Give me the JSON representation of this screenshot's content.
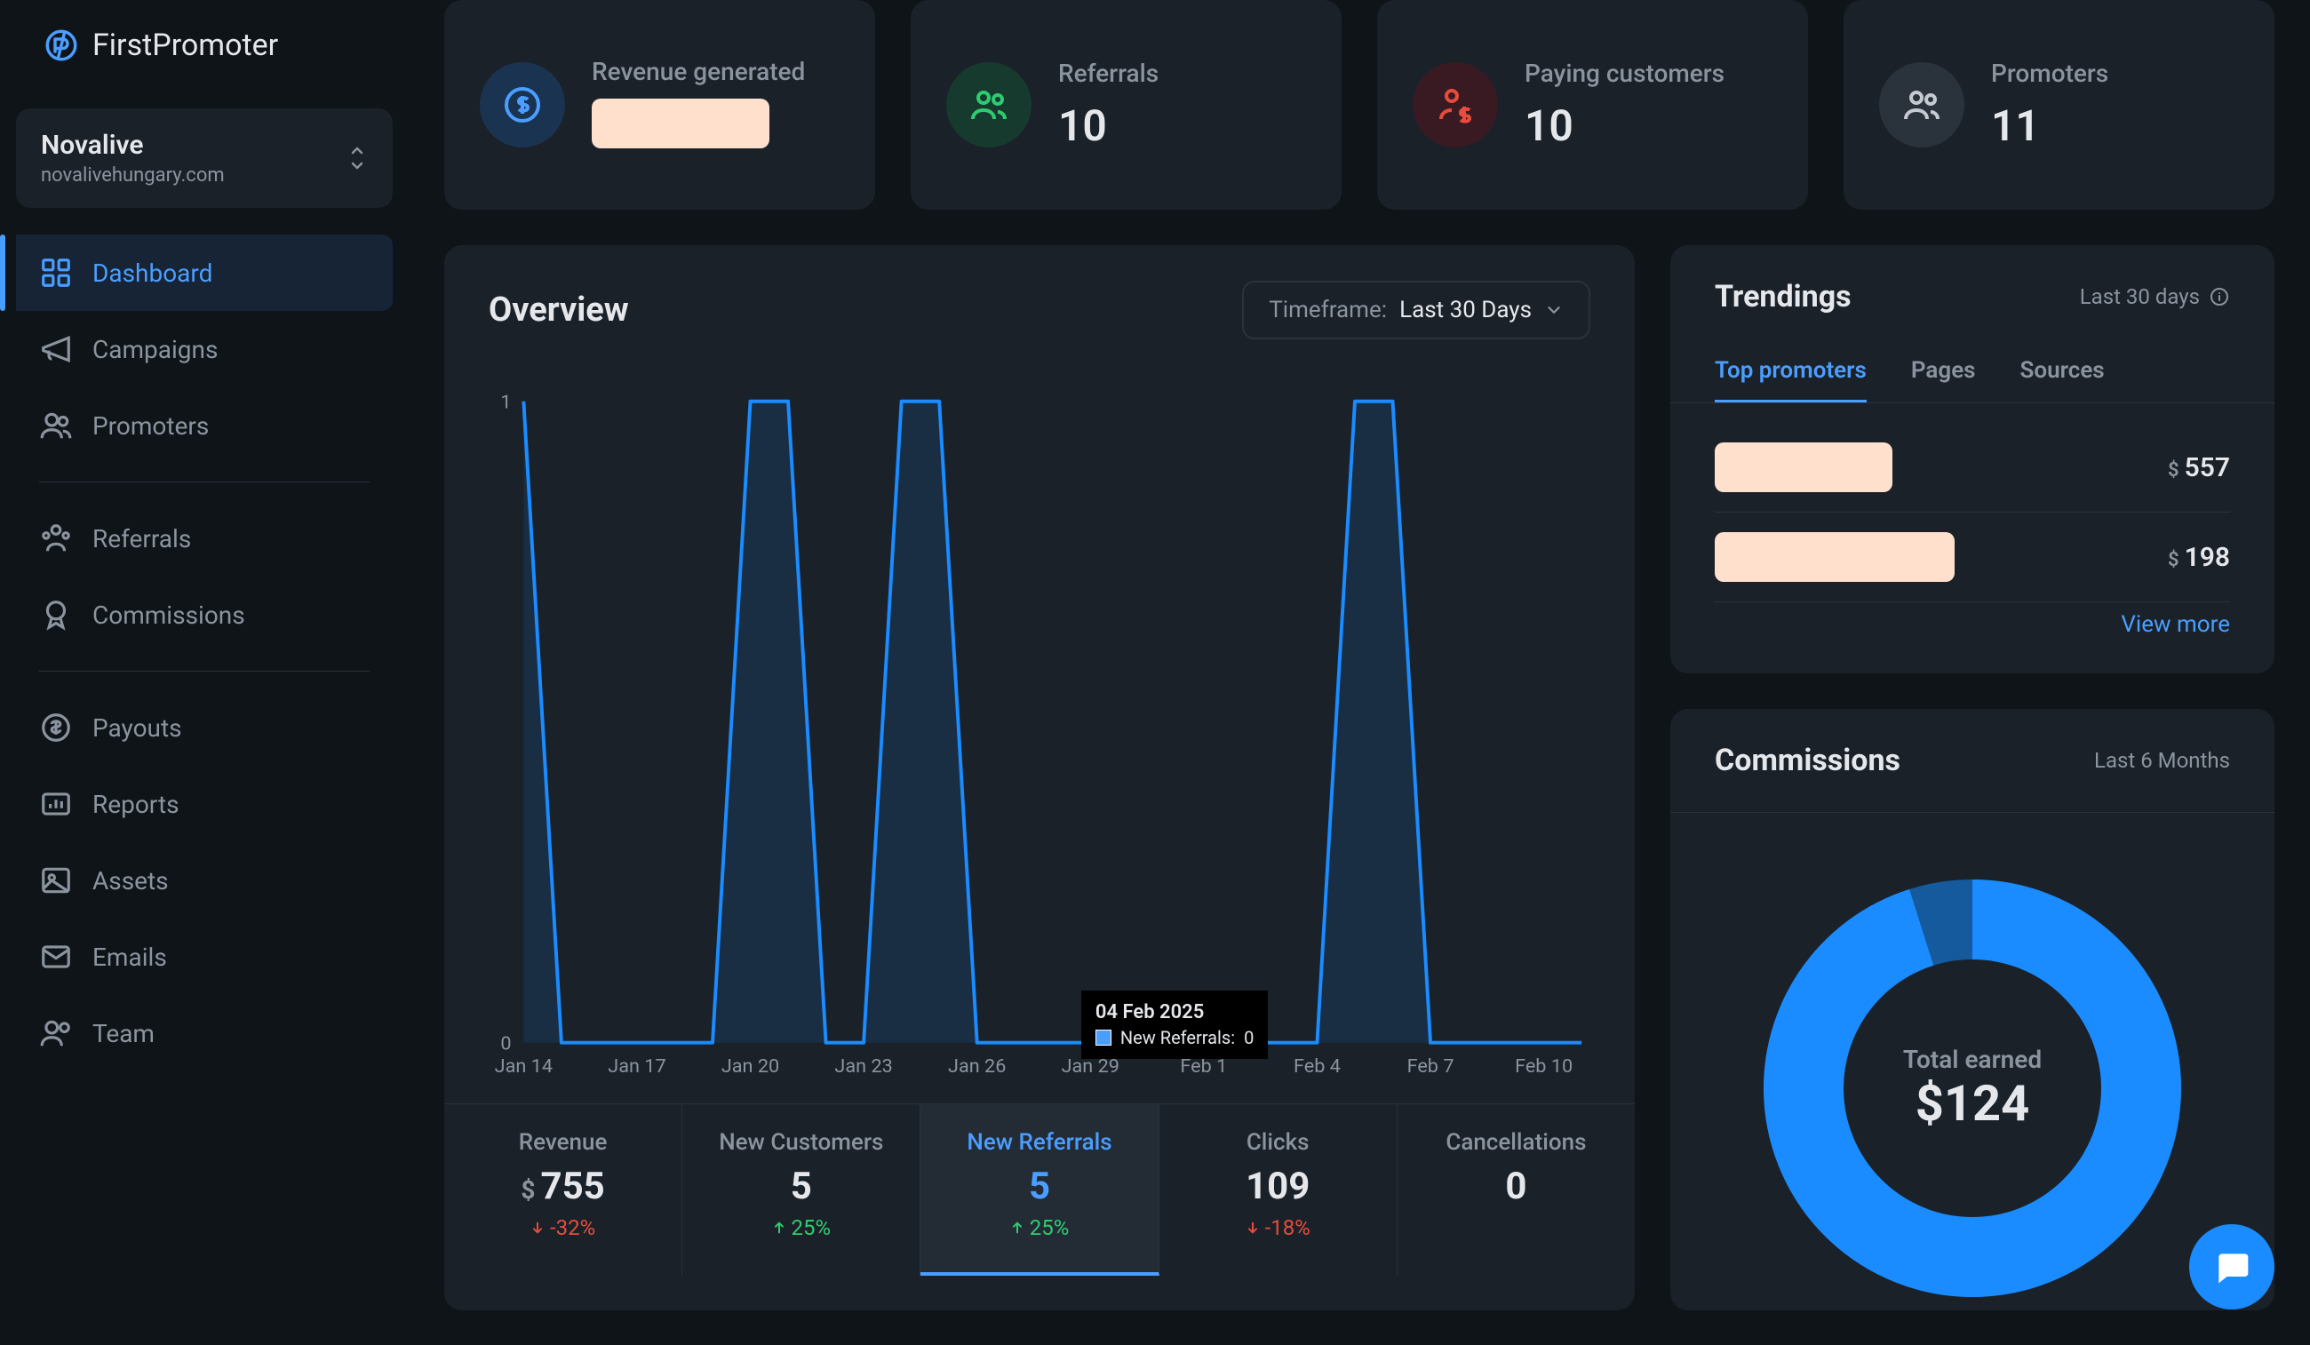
{
  "app": {
    "name": "FirstPromoter"
  },
  "org": {
    "name": "Novalive",
    "domain": "novalivehungary.com"
  },
  "nav": {
    "dashboard": "Dashboard",
    "campaigns": "Campaigns",
    "promoters": "Promoters",
    "referrals": "Referrals",
    "commissions": "Commissions",
    "payouts": "Payouts",
    "reports": "Reports",
    "assets": "Assets",
    "emails": "Emails",
    "team": "Team"
  },
  "cards": {
    "revenue": {
      "label": "Revenue generated"
    },
    "referrals": {
      "label": "Referrals",
      "value": "10"
    },
    "paying": {
      "label": "Paying customers",
      "value": "10"
    },
    "promoters": {
      "label": "Promoters",
      "value": "11"
    }
  },
  "overview": {
    "title": "Overview",
    "timeframe_label": "Timeframe:",
    "timeframe_value": "Last 30 Days",
    "tooltip": {
      "date": "04 Feb 2025",
      "series": "New Referrals:",
      "value": "0"
    }
  },
  "chart_data": {
    "type": "line",
    "title": "New Referrals",
    "ylabel": "",
    "ylim": [
      0,
      1
    ],
    "yticks": [
      0,
      1
    ],
    "categories": [
      "Jan 14",
      "Jan 15",
      "Jan 16",
      "Jan 17",
      "Jan 18",
      "Jan 19",
      "Jan 20",
      "Jan 21",
      "Jan 22",
      "Jan 23",
      "Jan 24",
      "Jan 25",
      "Jan 26",
      "Jan 27",
      "Jan 28",
      "Jan 29",
      "Jan 30",
      "Jan 31",
      "Feb 1",
      "Feb 2",
      "Feb 3",
      "Feb 4",
      "Feb 5",
      "Feb 6",
      "Feb 7",
      "Feb 8",
      "Feb 9",
      "Feb 10",
      "Feb 11"
    ],
    "x_tick_labels": [
      "Jan 14",
      "Jan 17",
      "Jan 20",
      "Jan 23",
      "Jan 26",
      "Jan 29",
      "Feb 1",
      "Feb 4",
      "Feb 7",
      "Feb 10"
    ],
    "series": [
      {
        "name": "New Referrals",
        "color": "#1a8cff",
        "values": [
          1,
          0,
          0,
          0,
          0,
          0,
          1,
          1,
          0,
          0,
          1,
          1,
          0,
          0,
          0,
          0,
          0,
          0,
          0,
          0,
          0,
          0,
          1,
          1,
          0,
          0,
          0,
          0,
          0
        ]
      }
    ]
  },
  "stats": {
    "revenue": {
      "label": "Revenue",
      "value": "755",
      "currency": "$",
      "delta": "-32%",
      "dir": "down"
    },
    "customers": {
      "label": "New Customers",
      "value": "5",
      "delta": "25%",
      "dir": "up"
    },
    "referrals": {
      "label": "New Referrals",
      "value": "5",
      "delta": "25%",
      "dir": "up"
    },
    "clicks": {
      "label": "Clicks",
      "value": "109",
      "delta": "-18%",
      "dir": "down"
    },
    "cancel": {
      "label": "Cancellations",
      "value": "0"
    }
  },
  "trendings": {
    "title": "Trendings",
    "sub": "Last 30 days",
    "tabs": {
      "top": "Top promoters",
      "pages": "Pages",
      "sources": "Sources"
    },
    "rows": [
      {
        "amount": "557"
      },
      {
        "amount": "198"
      }
    ],
    "view_more": "View more"
  },
  "commissions": {
    "title": "Commissions",
    "sub": "Last 6 Months",
    "total_label": "Total earned",
    "total_value": "$124"
  }
}
